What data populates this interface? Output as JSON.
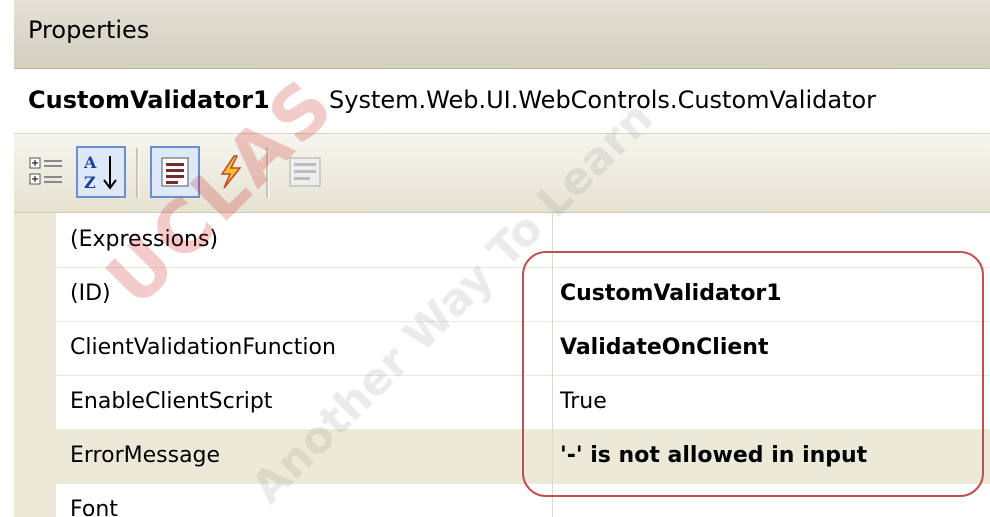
{
  "window": {
    "title": "Properties"
  },
  "object": {
    "name": "CustomValidator1",
    "type": "System.Web.UI.WebControls.CustomValidator"
  },
  "toolbar": {
    "buttons": [
      {
        "icon": "categorized-icon",
        "pressed": false
      },
      {
        "icon": "alphabetical-sort-icon",
        "pressed": true
      },
      {
        "icon": "properties-icon",
        "pressed": true
      },
      {
        "icon": "events-lightning-icon",
        "pressed": false
      },
      {
        "icon": "property-pages-icon",
        "pressed": false
      }
    ]
  },
  "properties": [
    {
      "name": "(Expressions)",
      "value": "",
      "bold": false
    },
    {
      "name": "(ID)",
      "value": "CustomValidator1",
      "bold": true
    },
    {
      "name": "ClientValidationFunction",
      "value": "ValidateOnClient",
      "bold": true
    },
    {
      "name": "EnableClientScript",
      "value": "True",
      "bold": false
    },
    {
      "name": "ErrorMessage",
      "value": "'-' is not allowed in input",
      "bold": true,
      "selected": true
    },
    {
      "name": "Font",
      "value": "",
      "bold": false
    }
  ],
  "watermark": {
    "text": "UCLAS",
    "tagline": "Another Way To Learn"
  },
  "colors": {
    "callout": "#c0504d",
    "watermark": "#c81414"
  }
}
